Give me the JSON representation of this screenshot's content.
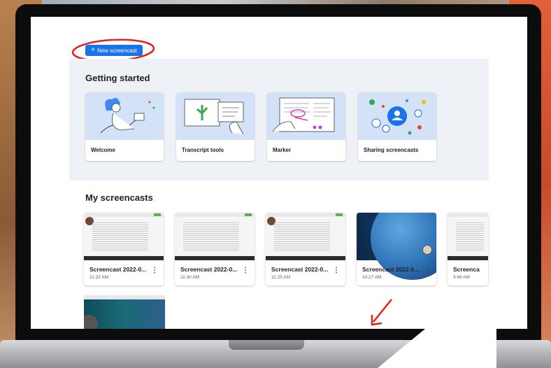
{
  "toolbar": {
    "new_label": "New screencast",
    "plus_glyph": "+"
  },
  "getting_started": {
    "title": "Getting started",
    "cards": [
      {
        "label": "Welcome",
        "icon": "welcome-illustration"
      },
      {
        "label": "Transcript tools",
        "icon": "transcript-illustration"
      },
      {
        "label": "Marker",
        "icon": "marker-illustration"
      },
      {
        "label": "Sharing screencasts",
        "icon": "sharing-illustration"
      }
    ]
  },
  "my_screencasts": {
    "title": "My screencasts",
    "items": [
      {
        "title": "Screencast 2022-0...",
        "time": "11:32 AM"
      },
      {
        "title": "Screencast 2022-0...",
        "time": "11:30 AM"
      },
      {
        "title": "Screencast 2022-0...",
        "time": "11:25 AM"
      },
      {
        "title": "Screencast 2022-0...",
        "time": "10:27 AM"
      },
      {
        "title": "Screenca",
        "time": "9:46 AM"
      }
    ]
  },
  "more_glyph": "⋮",
  "colors": {
    "accent": "#1a73e8",
    "annotation": "#e0231b",
    "panel": "#eef2f7"
  }
}
